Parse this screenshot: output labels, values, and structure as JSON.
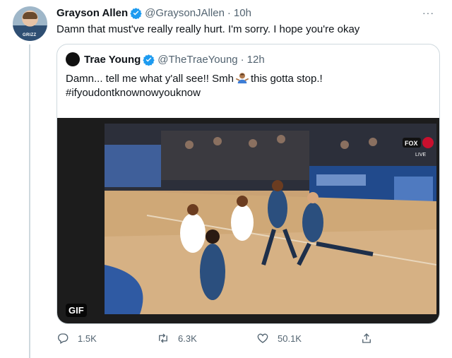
{
  "tweet": {
    "author_name": "Grayson Allen",
    "author_handle": "@GraysonJAllen",
    "time": "10h",
    "text": "Damn that must've really really hurt. I'm sorry. I hope you're okay",
    "more": "···",
    "avatar_shirt_text": "GRIZZ"
  },
  "quoted": {
    "author_name": "Trae Young",
    "author_handle": "@TheTraeYoung",
    "time": "12h",
    "text_line1_before": "Damn... tell me what y'all see!! Smh",
    "text_line1_after": "this gotta stop.!",
    "text_line2": "#ifyoudontknownowyouknow",
    "media_badge": "GIF",
    "broadcast_logo_left": "FOX",
    "broadcast_logo_live": "LIVE"
  },
  "actions": {
    "replies": "1.5K",
    "retweets": "6.3K",
    "likes": "50.1K"
  },
  "colors": {
    "verified": "#1d9bf0",
    "text": "#0f1419",
    "secondary": "#536471",
    "border": "#cfd9de"
  }
}
